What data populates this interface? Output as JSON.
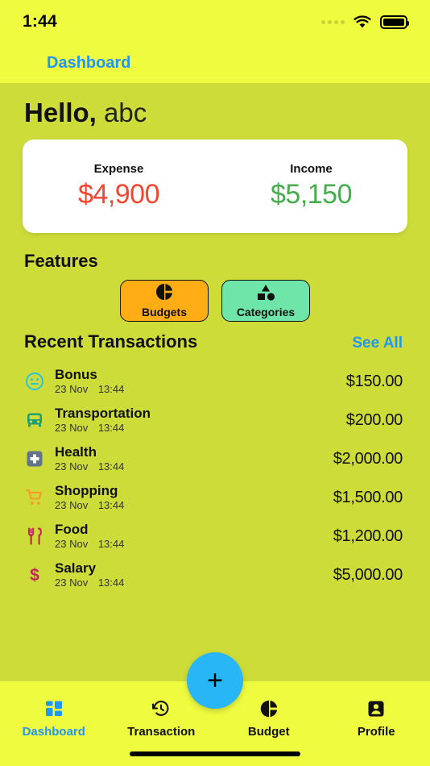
{
  "status_bar": {
    "time": "1:44",
    "signal_icon": "signal-dots-icon",
    "wifi_icon": "wifi-icon",
    "battery_icon": "battery-full-icon"
  },
  "navbar": {
    "title": "Dashboard"
  },
  "greeting": {
    "prefix": "Hello,",
    "name": "abc"
  },
  "balance": {
    "expense_label": "Expense",
    "expense_value": "$4,900",
    "expense_color": "#F4452F",
    "income_label": "Income",
    "income_value": "$5,150",
    "income_color": "#45AE4C"
  },
  "features": {
    "title": "Features",
    "items": [
      {
        "label": "Budgets",
        "icon": "pie-chart-icon",
        "bg": "#FFAC15"
      },
      {
        "label": "Categories",
        "icon": "shapes-icon",
        "bg": "#6FE5A9"
      }
    ]
  },
  "recent": {
    "title": "Recent Transactions",
    "see_all": "See All",
    "transactions": [
      {
        "title": "Bonus",
        "date": "23 Nov",
        "time": "13:44",
        "amount": "$150.00",
        "icon": "smiley-face-icon",
        "color": "#29C5DE"
      },
      {
        "title": "Transportation",
        "date": "23 Nov",
        "time": "13:44",
        "amount": "$200.00",
        "icon": "bus-icon",
        "color": "#1E9E72"
      },
      {
        "title": "Health",
        "date": "23 Nov",
        "time": "13:44",
        "amount": "$2,000.00",
        "icon": "medical-cross-icon",
        "color": "#61748C"
      },
      {
        "title": "Shopping",
        "date": "23 Nov",
        "time": "13:44",
        "amount": "$1,500.00",
        "icon": "shopping-cart-icon",
        "color": "#F79A2B"
      },
      {
        "title": "Food",
        "date": "23 Nov",
        "time": "13:44",
        "amount": "$1,200.00",
        "icon": "cutlery-icon",
        "color": "#C2295B"
      },
      {
        "title": "Salary",
        "date": "23 Nov",
        "time": "13:44",
        "amount": "$5,000.00",
        "icon": "dollar-sign-icon",
        "color": "#C2295B"
      }
    ]
  },
  "tabbar": {
    "add_button_icon": "plus-icon",
    "items": [
      {
        "label": "Dashboard",
        "icon": "grid-icon",
        "active": true
      },
      {
        "label": "Transaction",
        "icon": "history-icon",
        "active": false
      },
      {
        "label": "Budget",
        "icon": "pie-chart-icon",
        "active": false
      },
      {
        "label": "Profile",
        "icon": "person-icon",
        "active": false
      }
    ]
  },
  "colors": {
    "status_bg": "#EFFB3F",
    "content_bg": "#CDDC39",
    "accent_blue": "#2196F3",
    "fab_blue": "#29B6F6"
  }
}
